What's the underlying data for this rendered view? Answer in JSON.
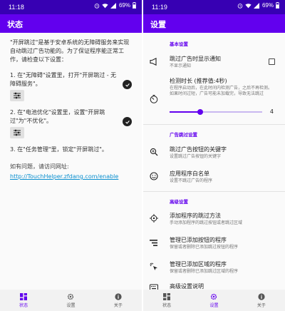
{
  "colors": {
    "primary": "#6200ee",
    "primary_dark": "#3700b3",
    "link": "#0a8fcf"
  },
  "left": {
    "status_bar": {
      "time": "11:18",
      "battery": "69%"
    },
    "app_bar_title": "状态",
    "intro": "\"开屏跳过\"是基于安卓系统的无障碍服务来实现自动跳过广告功能的。为了保证程序能正常工作，请检查以下设置：",
    "steps": [
      {
        "text": "1. 在\"无障碍\"设置里，打开\"开屏跳过 - 无障碍服务\"。",
        "completed": true
      },
      {
        "text": "2. 在\"电池优化\"设置里，设置\"开屏跳过\"为\"不优化\"。",
        "completed": true
      },
      {
        "text": "3. 在\"任务管理\"里，锁定\"开屏跳过\"。"
      }
    ],
    "help_text": "如有问题，请访问网址:",
    "help_link": "http://TouchHelper.zfdang.com/enable"
  },
  "right": {
    "status_bar": {
      "time": "11:19",
      "battery": "69%"
    },
    "app_bar_title": "设置",
    "sections": {
      "basic": "基本设置",
      "skip_ad": "广告跳过设置",
      "advanced": "高级设置"
    },
    "notify": {
      "title": "跳过广告时显示通知",
      "subtitle": "不显示通知",
      "checked": false
    },
    "duration": {
      "title": "检测时长 (推荐值:4秒)",
      "subtitle": "在程序启动后，在此时间内检测广告，之后不再检测。如果时间过短，广告可能未加载完，导致无法跳过",
      "value": "4",
      "slider_fraction": 0.33
    },
    "keywords": {
      "title": "跳过广告按钮的关键字",
      "subtitle": "设置跳过广告按钮的关键字"
    },
    "whitelist": {
      "title": "应用程序白名单",
      "subtitle": "设置不跳过广告的程序"
    },
    "add_method": {
      "title": "添加程序的跳过方法",
      "subtitle": "手动添加程序的跳过按钮或者跳过区域"
    },
    "manage_buttons": {
      "title": "管理已添加按钮的程序",
      "subtitle": "保留或者删除已添加跳过按钮的程序"
    },
    "manage_regions": {
      "title": "管理已添加区域的程序",
      "subtitle": "保留或者删除已添加跳过区域的程序"
    },
    "advanced_help": {
      "title": "高级设置说明"
    }
  },
  "bottom_nav": {
    "status": "状态",
    "settings": "设置",
    "about": "关于"
  }
}
